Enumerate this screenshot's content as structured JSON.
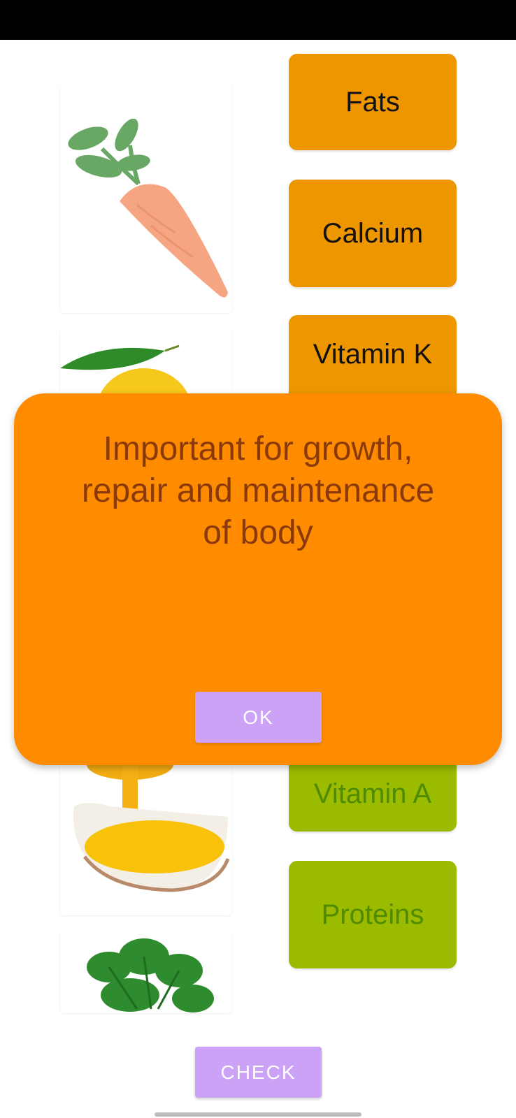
{
  "foods": [
    {
      "name": "carrot-image"
    },
    {
      "name": "lemon-image"
    },
    {
      "name": "ghee-image"
    },
    {
      "name": "spinach-image"
    }
  ],
  "nutrients": [
    {
      "label": "Fats",
      "state": "unmatched"
    },
    {
      "label": "Calcium",
      "state": "unmatched"
    },
    {
      "label": "Vitamin K",
      "state": "unmatched"
    },
    {
      "label": "Vitamin A",
      "state": "matched"
    },
    {
      "label": "Proteins",
      "state": "matched"
    }
  ],
  "dialog": {
    "message": "Important for growth, repair and maintenance of body",
    "ok_label": "OK"
  },
  "check_label": "CHECK",
  "colors": {
    "status_bar": "#000000",
    "unmatched_card": "#EE9600",
    "matched_card": "#9BBB00",
    "dialog_bg": "#FF8C00",
    "dialog_text": "#8A3A0A",
    "button_bg": "#CBA2F5"
  }
}
